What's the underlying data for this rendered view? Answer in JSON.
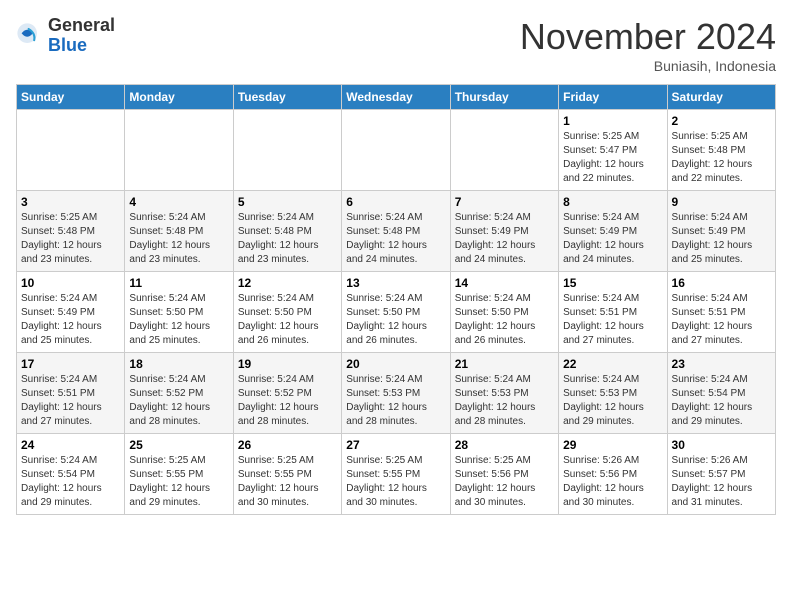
{
  "header": {
    "logo_general": "General",
    "logo_blue": "Blue",
    "month_title": "November 2024",
    "location": "Buniasih, Indonesia"
  },
  "days_of_week": [
    "Sunday",
    "Monday",
    "Tuesday",
    "Wednesday",
    "Thursday",
    "Friday",
    "Saturday"
  ],
  "weeks": [
    [
      {
        "day": "",
        "info": ""
      },
      {
        "day": "",
        "info": ""
      },
      {
        "day": "",
        "info": ""
      },
      {
        "day": "",
        "info": ""
      },
      {
        "day": "",
        "info": ""
      },
      {
        "day": "1",
        "info": "Sunrise: 5:25 AM\nSunset: 5:47 PM\nDaylight: 12 hours and 22 minutes."
      },
      {
        "day": "2",
        "info": "Sunrise: 5:25 AM\nSunset: 5:48 PM\nDaylight: 12 hours and 22 minutes."
      }
    ],
    [
      {
        "day": "3",
        "info": "Sunrise: 5:25 AM\nSunset: 5:48 PM\nDaylight: 12 hours and 23 minutes."
      },
      {
        "day": "4",
        "info": "Sunrise: 5:24 AM\nSunset: 5:48 PM\nDaylight: 12 hours and 23 minutes."
      },
      {
        "day": "5",
        "info": "Sunrise: 5:24 AM\nSunset: 5:48 PM\nDaylight: 12 hours and 23 minutes."
      },
      {
        "day": "6",
        "info": "Sunrise: 5:24 AM\nSunset: 5:48 PM\nDaylight: 12 hours and 24 minutes."
      },
      {
        "day": "7",
        "info": "Sunrise: 5:24 AM\nSunset: 5:49 PM\nDaylight: 12 hours and 24 minutes."
      },
      {
        "day": "8",
        "info": "Sunrise: 5:24 AM\nSunset: 5:49 PM\nDaylight: 12 hours and 24 minutes."
      },
      {
        "day": "9",
        "info": "Sunrise: 5:24 AM\nSunset: 5:49 PM\nDaylight: 12 hours and 25 minutes."
      }
    ],
    [
      {
        "day": "10",
        "info": "Sunrise: 5:24 AM\nSunset: 5:49 PM\nDaylight: 12 hours and 25 minutes."
      },
      {
        "day": "11",
        "info": "Sunrise: 5:24 AM\nSunset: 5:50 PM\nDaylight: 12 hours and 25 minutes."
      },
      {
        "day": "12",
        "info": "Sunrise: 5:24 AM\nSunset: 5:50 PM\nDaylight: 12 hours and 26 minutes."
      },
      {
        "day": "13",
        "info": "Sunrise: 5:24 AM\nSunset: 5:50 PM\nDaylight: 12 hours and 26 minutes."
      },
      {
        "day": "14",
        "info": "Sunrise: 5:24 AM\nSunset: 5:50 PM\nDaylight: 12 hours and 26 minutes."
      },
      {
        "day": "15",
        "info": "Sunrise: 5:24 AM\nSunset: 5:51 PM\nDaylight: 12 hours and 27 minutes."
      },
      {
        "day": "16",
        "info": "Sunrise: 5:24 AM\nSunset: 5:51 PM\nDaylight: 12 hours and 27 minutes."
      }
    ],
    [
      {
        "day": "17",
        "info": "Sunrise: 5:24 AM\nSunset: 5:51 PM\nDaylight: 12 hours and 27 minutes."
      },
      {
        "day": "18",
        "info": "Sunrise: 5:24 AM\nSunset: 5:52 PM\nDaylight: 12 hours and 28 minutes."
      },
      {
        "day": "19",
        "info": "Sunrise: 5:24 AM\nSunset: 5:52 PM\nDaylight: 12 hours and 28 minutes."
      },
      {
        "day": "20",
        "info": "Sunrise: 5:24 AM\nSunset: 5:53 PM\nDaylight: 12 hours and 28 minutes."
      },
      {
        "day": "21",
        "info": "Sunrise: 5:24 AM\nSunset: 5:53 PM\nDaylight: 12 hours and 28 minutes."
      },
      {
        "day": "22",
        "info": "Sunrise: 5:24 AM\nSunset: 5:53 PM\nDaylight: 12 hours and 29 minutes."
      },
      {
        "day": "23",
        "info": "Sunrise: 5:24 AM\nSunset: 5:54 PM\nDaylight: 12 hours and 29 minutes."
      }
    ],
    [
      {
        "day": "24",
        "info": "Sunrise: 5:24 AM\nSunset: 5:54 PM\nDaylight: 12 hours and 29 minutes."
      },
      {
        "day": "25",
        "info": "Sunrise: 5:25 AM\nSunset: 5:55 PM\nDaylight: 12 hours and 29 minutes."
      },
      {
        "day": "26",
        "info": "Sunrise: 5:25 AM\nSunset: 5:55 PM\nDaylight: 12 hours and 30 minutes."
      },
      {
        "day": "27",
        "info": "Sunrise: 5:25 AM\nSunset: 5:55 PM\nDaylight: 12 hours and 30 minutes."
      },
      {
        "day": "28",
        "info": "Sunrise: 5:25 AM\nSunset: 5:56 PM\nDaylight: 12 hours and 30 minutes."
      },
      {
        "day": "29",
        "info": "Sunrise: 5:26 AM\nSunset: 5:56 PM\nDaylight: 12 hours and 30 minutes."
      },
      {
        "day": "30",
        "info": "Sunrise: 5:26 AM\nSunset: 5:57 PM\nDaylight: 12 hours and 31 minutes."
      }
    ]
  ]
}
